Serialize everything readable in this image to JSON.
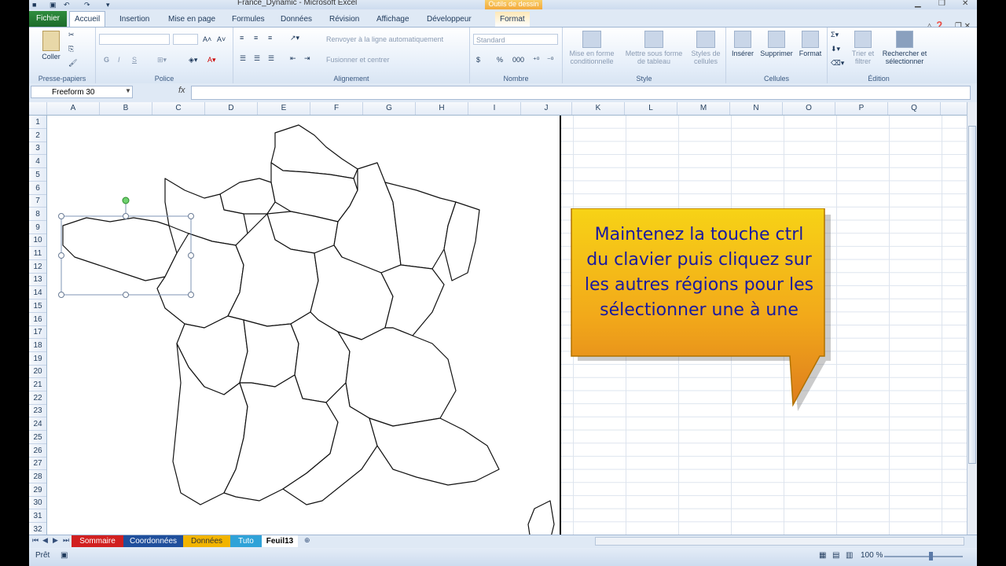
{
  "window": {
    "title": "France_Dynamic  -  Microsoft Excel",
    "context_tab_band": "Outils de dessin"
  },
  "tabs": [
    "Fichier",
    "Accueil",
    "Insertion",
    "Mise en page",
    "Formules",
    "Données",
    "Révision",
    "Affichage",
    "Développeur",
    "Format"
  ],
  "active_tab": "Accueil",
  "ribbon": {
    "clipboard": {
      "paste_label": "Coller",
      "group_label": "Presse-papiers"
    },
    "font": {
      "group_label": "Police",
      "bold": "G",
      "italic": "I",
      "underline": "S"
    },
    "alignment": {
      "group_label": "Alignement",
      "wrap_label": "Renvoyer à la ligne automatiquement",
      "merge_label": "Fusionner et centrer"
    },
    "number": {
      "group_label": "Nombre",
      "format_value": "Standard",
      "currency": "$",
      "percent": "%",
      "thousands": "000"
    },
    "style": {
      "group_label": "Style",
      "conditional": "Mise en forme conditionnelle",
      "as_table": "Mettre sous forme de tableau",
      "cell_styles": "Styles de cellules"
    },
    "cells": {
      "group_label": "Cellules",
      "insert": "Insérer",
      "delete": "Supprimer",
      "format": "Format"
    },
    "editing": {
      "group_label": "Édition",
      "sort_filter": "Trier et filtrer",
      "find_select": "Rechercher et sélectionner"
    }
  },
  "formula_bar": {
    "name_box": "Freeform 30",
    "fx": "fx",
    "value": ""
  },
  "columns": [
    "A",
    "B",
    "C",
    "D",
    "E",
    "F",
    "G",
    "H",
    "I",
    "J",
    "K",
    "L",
    "M",
    "N",
    "O",
    "P",
    "Q"
  ],
  "rows": [
    "1",
    "2",
    "3",
    "4",
    "5",
    "6",
    "7",
    "8",
    "9",
    "10",
    "11",
    "12",
    "13",
    "14",
    "15",
    "16",
    "17",
    "18",
    "19",
    "20",
    "21",
    "22",
    "23",
    "24",
    "25",
    "26",
    "27",
    "28",
    "29",
    "30",
    "31",
    "32"
  ],
  "callout": {
    "line1": "Maintenez la touche ctrl",
    "line2": "du clavier puis cliquez sur",
    "line3": "les autres régions pour les",
    "line4": "sélectionner une à une"
  },
  "sheets": [
    {
      "name": "Sommaire",
      "color": "#d12020"
    },
    {
      "name": "Coordonnées",
      "color": "#1f4f9c"
    },
    {
      "name": "Données",
      "color": "#f2b400"
    },
    {
      "name": "Tuto",
      "color": "#2fa2d8"
    },
    {
      "name": "Feuil13",
      "color": "#ffffff"
    }
  ],
  "active_sheet": "Feuil13",
  "status": {
    "ready": "Prêt",
    "zoom": "100 %"
  }
}
